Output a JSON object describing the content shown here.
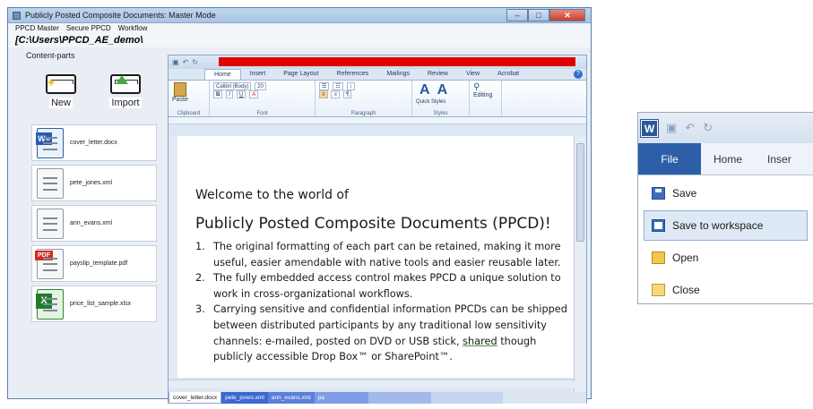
{
  "window": {
    "title": "Publicly Posted Composite Documents: Master Mode",
    "controls": {
      "minimize": "–",
      "maximize": "□",
      "close": "✕"
    }
  },
  "menubar": [
    "PPCD Master",
    "Secure PPCD",
    "Workflow"
  ],
  "path": "[C:\\Users\\PPCD_AE_demo\\",
  "content_parts": {
    "label": "Content-parts",
    "new_label": "New",
    "import_label": "Import",
    "files": [
      {
        "name": "cover_letter.docx",
        "type": "word",
        "badge": "W≡"
      },
      {
        "name": "pete_jones.xml",
        "type": "xml",
        "badge": ""
      },
      {
        "name": "ann_evans.xml",
        "type": "xml",
        "badge": ""
      },
      {
        "name": "payslip_template.pdf",
        "type": "pdf",
        "badge": "PDF"
      },
      {
        "name": "price_list_sample.xlsx",
        "type": "excel",
        "badge": "X"
      }
    ]
  },
  "word": {
    "ribbon_tabs": [
      "Home",
      "Insert",
      "Page Layout",
      "References",
      "Mailings",
      "Review",
      "View",
      "Acrobat"
    ],
    "font_name": "Calibri (Body)",
    "font_size": "20",
    "groups": {
      "clipboard": "Clipboard",
      "font": "Font",
      "paragraph": "Paragraph",
      "styles": "Styles",
      "editing": "Editing"
    },
    "paste_label": "Paste",
    "quick_styles": "Quick Styles",
    "change_styles": "Change Styles",
    "document": {
      "heading1": "Welcome to the world of",
      "heading2": "Publicly Posted Composite Documents (PPCD)!",
      "items": [
        {
          "num": "1.",
          "text": "The original formatting of each part can be retained, making it more useful, easier amendable with native tools and easier reusable later."
        },
        {
          "num": "2.",
          "text": "The fully embedded access control makes PPCD a unique solution to work in cross-organizational  workflows."
        },
        {
          "num": "3.",
          "text_before": "Carrying sensitive and confidential information PPCDs can be shipped between distributed participants by any traditional low sensitivity channels: e-mailed, posted on DVD or USB stick, ",
          "text_underlined": "shared",
          "text_after": " though publicly accessible Drop Box™ or SharePoint™."
        }
      ]
    },
    "doc_tabs": [
      "cover_letter.docx",
      "pete_jones.xml",
      "ann_evans.xml",
      "pa",
      "",
      ""
    ]
  },
  "file_menu": {
    "tabs": {
      "file": "File",
      "home": "Home",
      "insert": "Inser"
    },
    "items": [
      {
        "label": "Save",
        "icon": "save-icon"
      },
      {
        "label": "Save to workspace",
        "icon": "workspace-icon"
      },
      {
        "label": "Open",
        "icon": "open-folder-icon"
      },
      {
        "label": "Close",
        "icon": "close-folder-icon"
      }
    ]
  },
  "colors": {
    "red_bar": "#e00000",
    "file_tab": "#2c5fa8",
    "highlight": "#dfe9f6"
  }
}
